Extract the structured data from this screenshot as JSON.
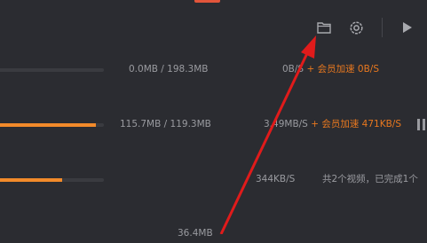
{
  "toolbar": {
    "folder_icon": "folder-icon",
    "settings_icon": "gear-icon",
    "play_icon": "play-icon"
  },
  "downloads": [
    {
      "size": "0.0MB / 198.3MB",
      "speed": "0B/S",
      "vip": "+ 会员加速 0B/S",
      "progress": 0.0
    },
    {
      "size": "115.7MB / 119.3MB",
      "speed": "3.49MB/S",
      "vip": "+ 会员加速 471KB/S",
      "progress": 0.92
    },
    {
      "size": "",
      "speed": "344KB/S",
      "info": "共2个视频，已完成1个",
      "progress": 0.6
    },
    {
      "size": "36.4MB",
      "speed": "",
      "progress": null
    }
  ],
  "colors": {
    "background": "#2b2c31",
    "accent_orange": "#f28a2a",
    "vip_orange": "#e8781f",
    "annotation_red": "#e01b1b"
  }
}
